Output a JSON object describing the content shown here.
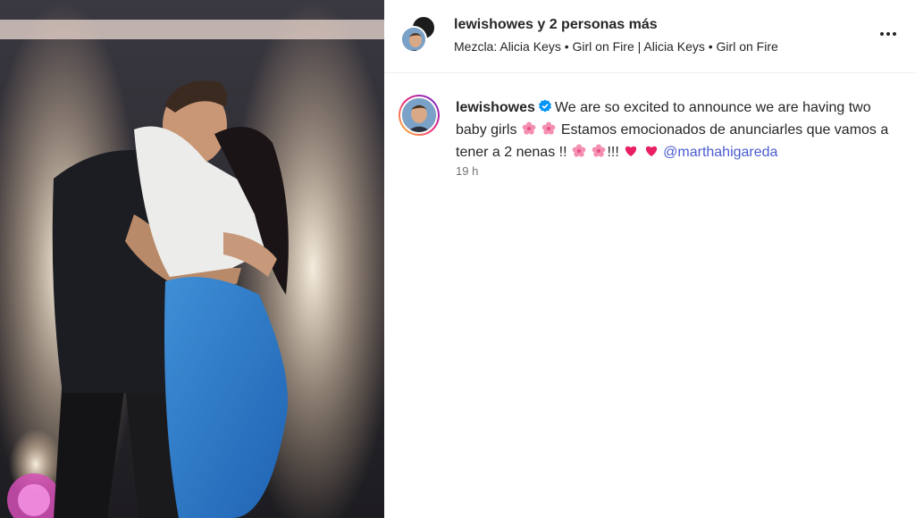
{
  "post": {
    "header": {
      "username": "lewishowes",
      "others": " y 2 personas más",
      "music_prefix": "Mezcla: ",
      "music_text": "Alicia Keys • Girl on Fire | Alicia Keys • Girl on Fire",
      "more_label": "Más opciones"
    },
    "caption": {
      "username": "lewishowes",
      "text_1": "We are so excited to announce we are having two baby girls",
      "text_2": "Estamos emocionados de anunciarles que vamos a tener a 2 nenas !!",
      "text_3": "!!!",
      "mention": "@marthahigareda",
      "time": "19 h",
      "verified": true
    },
    "icons": {
      "more": "more-horizontal-icon",
      "verified": "verified-badge-icon",
      "flower": "cherry-blossom-emoji",
      "heart": "pink-heart-emoji"
    },
    "colors": {
      "mention": "#4a5cd0",
      "verified": "#0095f6",
      "flower": "#f48fb1",
      "heart": "#e91e63",
      "timestamp": "#737373"
    }
  }
}
